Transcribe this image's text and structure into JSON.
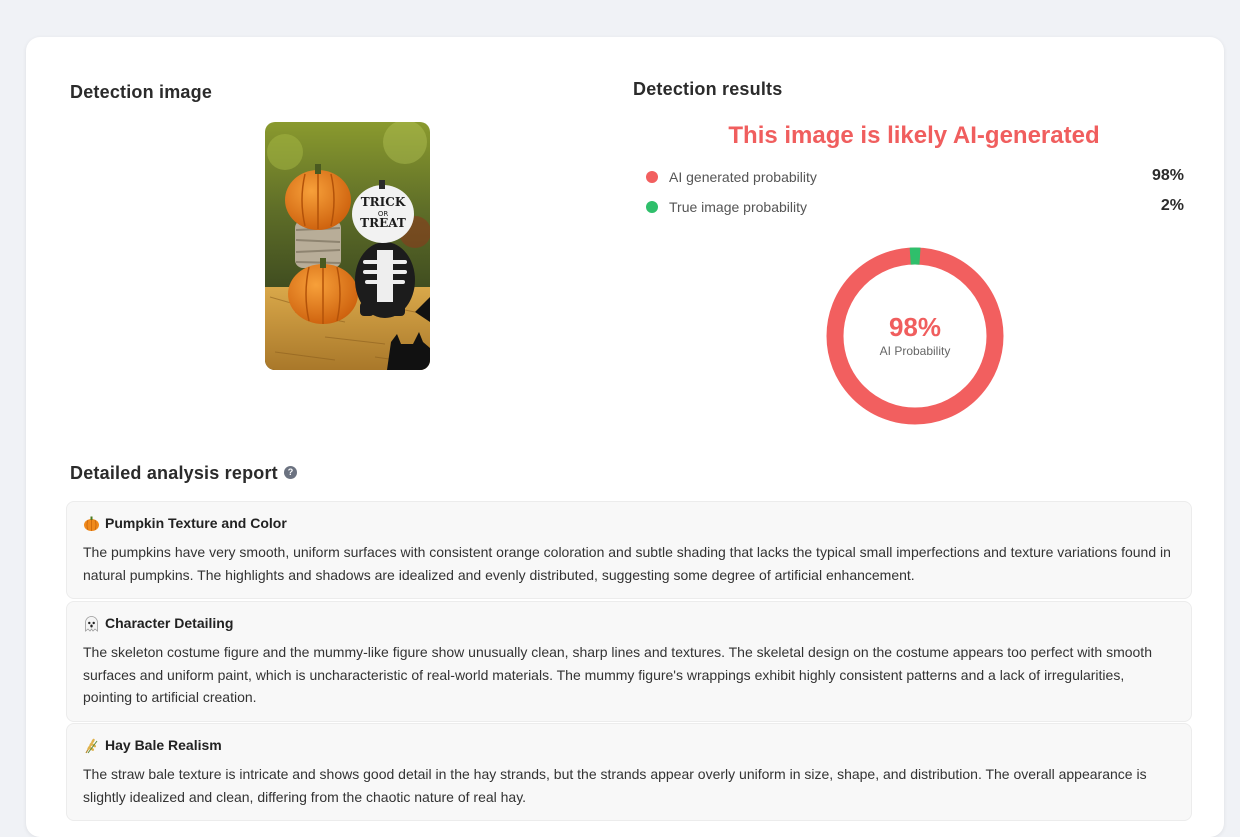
{
  "detection_image": {
    "title": "Detection image",
    "image_text": [
      "TRICK",
      "OR",
      "TREAT"
    ]
  },
  "results": {
    "title": "Detection results",
    "verdict": "This image is likely AI-generated",
    "ai_label": "AI generated probability",
    "ai_value": "98%",
    "true_label": "True image probability",
    "true_value": "2%",
    "donut": {
      "ai_probability": 98,
      "center_value": "98%",
      "center_label": "AI Probability"
    },
    "colors": {
      "ai": "#f25f5f",
      "true": "#2fbf6b"
    }
  },
  "report": {
    "title": "Detailed analysis report",
    "help_icon": "?",
    "items": [
      {
        "icon": "pumpkin-icon",
        "title": "Pumpkin Texture and Color",
        "body": "The pumpkins have very smooth, uniform surfaces with consistent orange coloration and subtle shading that lacks the typical small imperfections and texture variations found in natural pumpkins. The highlights and shadows are idealized and evenly distributed, suggesting some degree of artificial enhancement."
      },
      {
        "icon": "ghost-icon",
        "title": "Character Detailing",
        "body": "The skeleton costume figure and the mummy-like figure show unusually clean, sharp lines and textures. The skeletal design on the costume appears too perfect with smooth surfaces and uniform paint, which is uncharacteristic of real-world materials. The mummy figure's wrappings exhibit highly consistent patterns and a lack of irregularities, pointing to artificial creation."
      },
      {
        "icon": "wheat-icon",
        "title": "Hay Bale Realism",
        "body": "The straw bale texture is intricate and shows good detail in the hay strands, but the strands appear overly uniform in size, shape, and distribution. The overall appearance is slightly idealized and clean, differing from the chaotic nature of real hay."
      }
    ]
  }
}
